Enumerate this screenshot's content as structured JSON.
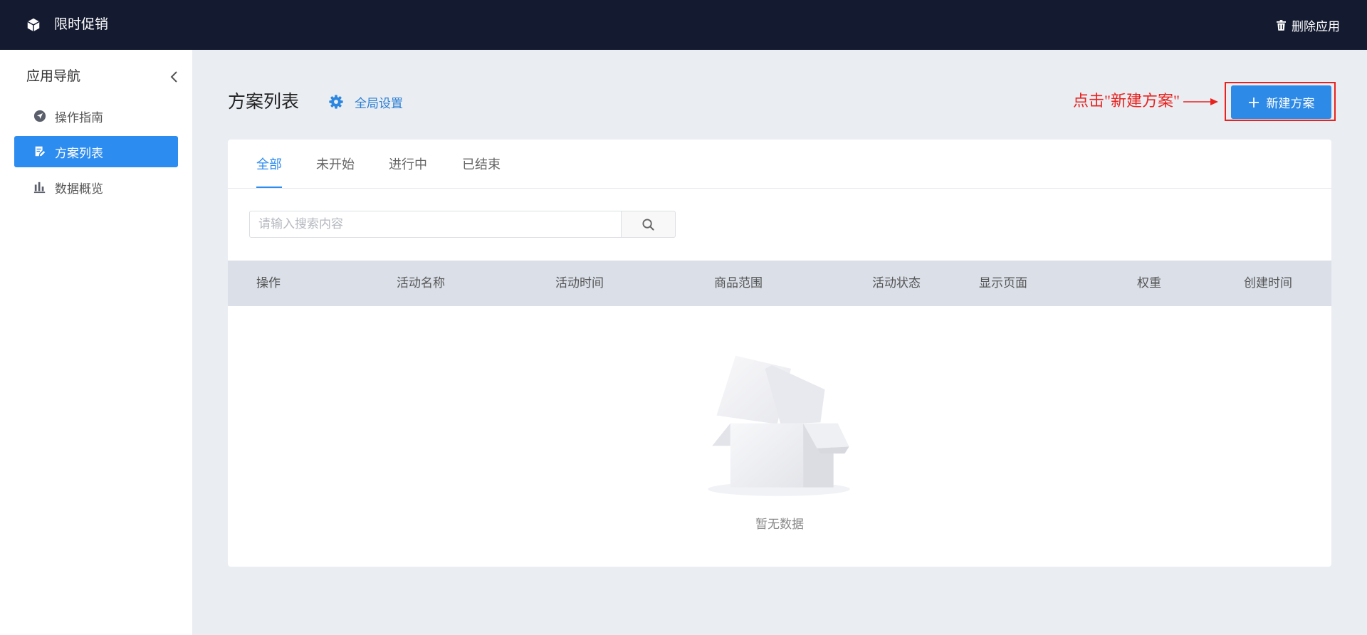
{
  "app": {
    "title": "限时促销",
    "logo_icon": "cube-icon",
    "delete_label": "删除应用",
    "delete_icon": "trash-icon"
  },
  "sidebar": {
    "heading": "应用导航",
    "collapse_icon": "chevron-left-icon",
    "items": [
      {
        "label": "操作指南",
        "icon": "navigation-icon",
        "active": false
      },
      {
        "label": "方案列表",
        "icon": "edit-document-icon",
        "active": true
      },
      {
        "label": "数据概览",
        "icon": "bar-chart-icon",
        "active": false
      }
    ]
  },
  "main": {
    "title": "方案列表",
    "settings_label": "全局设置",
    "settings_icon": "gear-icon",
    "annotation": "点击\"新建方案\"",
    "new_button_label": "新建方案",
    "new_button_icon": "plus-icon"
  },
  "tabs": [
    {
      "label": "全部",
      "active": true
    },
    {
      "label": "未开始",
      "active": false
    },
    {
      "label": "进行中",
      "active": false
    },
    {
      "label": "已结束",
      "active": false
    }
  ],
  "search": {
    "placeholder": "请输入搜索内容",
    "value": "",
    "button_icon": "search-icon"
  },
  "table": {
    "columns": [
      "操作",
      "活动名称",
      "活动时间",
      "商品范围",
      "活动状态",
      "显示页面",
      "权重",
      "创建时间"
    ],
    "rows": [],
    "empty_text": "暂无数据"
  },
  "colors": {
    "header_bg": "#141b31",
    "accent": "#2d8cf0",
    "annotation": "#e8231f",
    "page_bg": "#eaedf2",
    "table_header_bg": "#dadfe8"
  }
}
